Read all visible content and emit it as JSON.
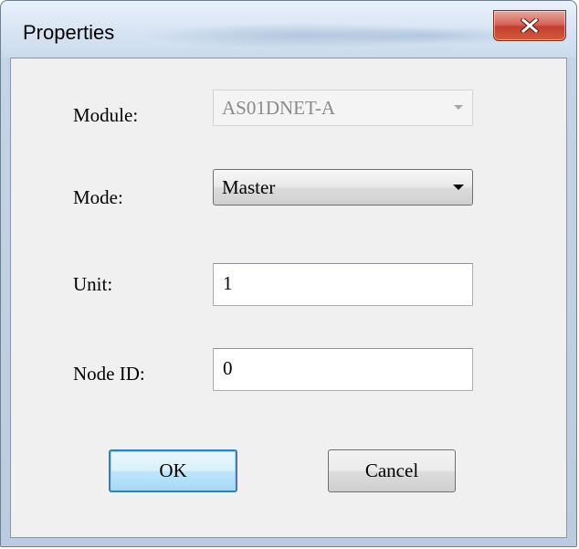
{
  "window": {
    "title": "Properties"
  },
  "title_bar": {
    "close_icon": "close-x-icon",
    "close_color": "#c9463a"
  },
  "form": {
    "module_label": "Module:",
    "module_value": "AS01DNET-A",
    "mode_label": "Mode:",
    "mode_value": "Master",
    "unit_label": "Unit:",
    "unit_value": "1",
    "node_id_label": "Node ID:",
    "node_id_value": "0"
  },
  "buttons": {
    "ok_label": "OK",
    "cancel_label": "Cancel"
  }
}
